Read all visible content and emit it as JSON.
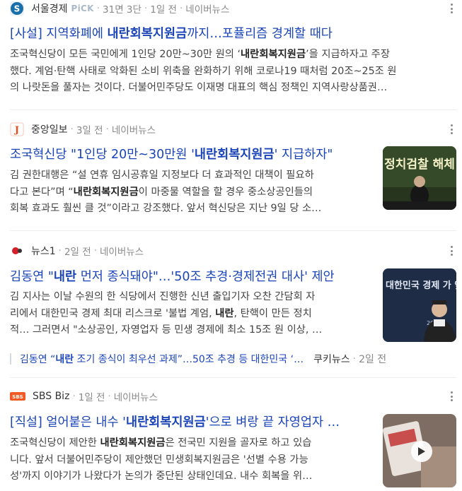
{
  "articles": [
    {
      "press": "서울경제",
      "pick": "PiCK",
      "position": "31면 3단",
      "time": "1일 전",
      "portal": "네이버뉴스",
      "title_pre": "[사설] 지역화폐에 ",
      "title_bold": "내란회복지원금",
      "title_post": "까지…포퓰리즘 경계할 때다",
      "body_l1_pre": "조국혁신당이 모든 국민에게 1인당 20만~30만 원의 ‘",
      "body_l1_bold": "내란회복지원금",
      "body_l1_post": "’을 지급하자고 주장",
      "body_l2": "했다. 계엄·탄핵 사태로 악화된 소비 위축을 완화하기 위해 코로나19 때처럼 20조~25조 원",
      "body_l3": "의 나랏돈을 풀자는 것이다. 더불어민주당도 이재명 대표의 핵심 정책인 지역사랑상품권…"
    },
    {
      "press": "중앙일보",
      "time": "3일 전",
      "portal": "네이버뉴스",
      "title_pre": "조국혁신당 \"1인당 20만~30만원 '",
      "title_bold": "내란회복지원금",
      "title_post": "' 지급하자\"",
      "body_l1": "김 권한대행은 “설 연휴 임시공휴일 지정보다 더 효과적인 대책이 필요하",
      "body_l2_pre": "다고 본다”며 “",
      "body_l2_bold": "내란회복지원금",
      "body_l2_post": "이 마중물 역할을 할 경우 중소상공인들의",
      "body_l3": "회복 효과도 훨씬 클 것”이라고 강조했다. 앞서 혁신당은 지난 9일 당 소…",
      "thumb_text": "정치검찰 해체"
    },
    {
      "press": "뉴스1",
      "time": "2일 전",
      "portal": "네이버뉴스",
      "title_pre": "김동연 \"",
      "title_bold": "내란",
      "title_post": " 먼저 종식돼야\"…'50조 추경·경제전권 대사' 제안",
      "body_l1": "김 지사는 이날 수원의 한 식당에서 진행한 신년 출입기자 오찬 간담회 자",
      "body_l2_pre": "리에서 대한민국 경제 최대 리스크로 '불법 계엄, ",
      "body_l2_bold": "내란",
      "body_l2_post": ", 탄핵이 만든 정치",
      "body_l3": "적… 그러면서 \"소상공인, 자영업자 등 민생 경제에 최소 15조 원 이상, …",
      "thumb_text": "대한민국 경제 가 앞장섭니다",
      "thumb_year": "2025",
      "related": {
        "title_pre": "김동연 “",
        "title_bold": "내란",
        "title_post": " 조기 종식이 최우선 과제”…50조 추경 등 대한민국 ‘…",
        "press": "쿠키뉴스",
        "time": "2일 전"
      }
    },
    {
      "press": "SBS Biz",
      "time": "1일 전",
      "portal": "네이버뉴스",
      "title_pre": "[직설] 얼어붙은 내수 '",
      "title_bold": "내란회복지원금",
      "title_post": "'으로 벼랑 끝 자영업자 …",
      "body_l1_pre": "조국혁신당이 제안한 ",
      "body_l1_bold": "내란회복지원금",
      "body_l1_post": "은 전국민 지원을 골자로 하고 있습",
      "body_l2": "니다. 앞서 더불어민주당이 제안했던 민생회복지원금은 '선별 수용 가능",
      "body_l3": "성'까지 이야기가 나왔다가 논의가 중단된 상태인데요. 내수 회복을 위…"
    }
  ],
  "colors": {
    "title_link": "#1a44b8",
    "logo_seoul": "#1a6fa8",
    "logo_joongang": "#e84e1b",
    "logo_news1": "#d3202a",
    "logo_sbs": "#f15a24"
  }
}
